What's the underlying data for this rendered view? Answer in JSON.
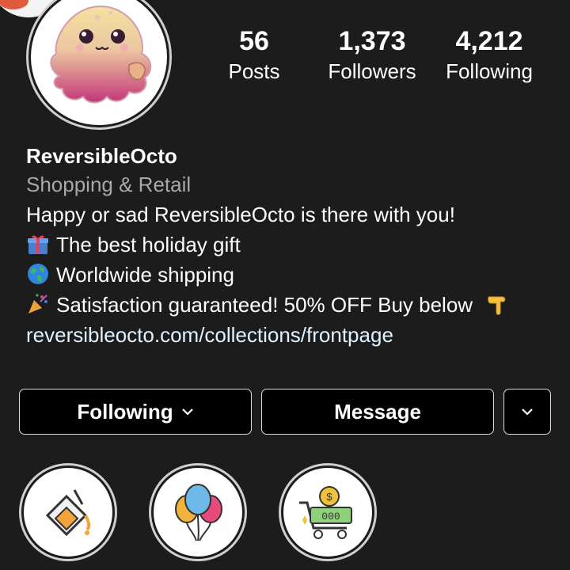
{
  "profile": {
    "username": "ReversibleOcto",
    "category": "Shopping & Retail",
    "bio_lines": [
      "Happy or sad ReversibleOcto is there with you!",
      "The best holiday gift",
      "Worldwide shipping",
      "Satisfaction guaranteed! 50% OFF Buy below"
    ],
    "link": "reversibleocto.com/collections/frontpage"
  },
  "stats": {
    "posts": {
      "value": "56",
      "label": "Posts"
    },
    "followers": {
      "value": "1,373",
      "label": "Followers"
    },
    "following": {
      "value": "4,212",
      "label": "Following"
    }
  },
  "actions": {
    "following_label": "Following",
    "message_label": "Message"
  },
  "icons": {
    "bio_1": "gift-icon",
    "bio_2": "globe-icon",
    "bio_3": "party-popper-icon",
    "bio_3_trailing": "pointing-down-hand-icon",
    "highlight_1": "paint-bucket-icon",
    "highlight_2": "balloons-icon",
    "highlight_3": "shopping-cart-coin-icon"
  },
  "colors": {
    "background": "#1c1c1c",
    "text": "#ffffff",
    "secondary_text": "#a8a8a8",
    "link": "#e0f1ff"
  }
}
